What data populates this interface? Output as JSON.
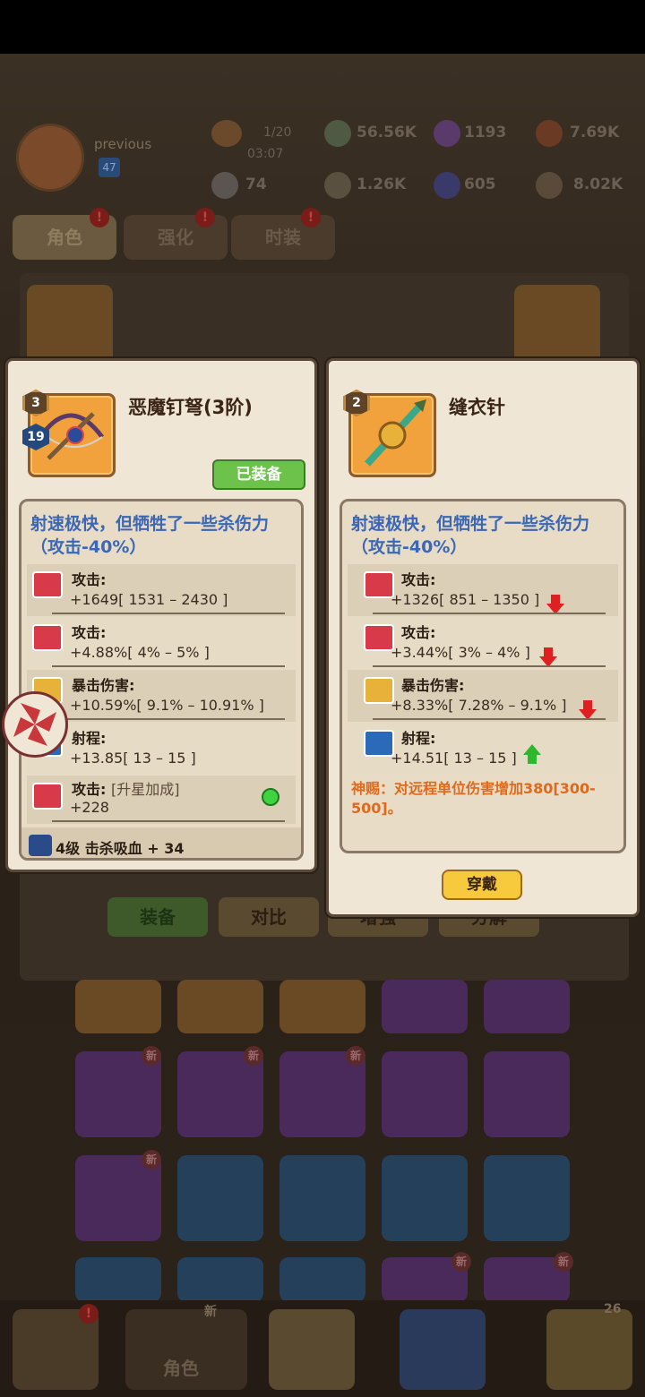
{
  "topbar": {
    "player_name": "previous",
    "player_level": "47",
    "energy_count": "1/20",
    "energy_timer": "03:07",
    "resources": [
      "56.56K",
      "1193",
      "7.69K",
      "74",
      "1.26K",
      "605",
      "8.02K"
    ]
  },
  "tabs": [
    {
      "label": "角色",
      "badge": "!"
    },
    {
      "label": "强化",
      "badge": "!"
    },
    {
      "label": "时装",
      "badge": "!"
    }
  ],
  "grid_badges": {
    "new": "新"
  },
  "bottom_buttons": [
    {
      "label": "装备"
    },
    {
      "label": "对比"
    },
    {
      "label": "增强"
    },
    {
      "label": "分解"
    }
  ],
  "nav": {
    "character_label": "角色",
    "new_badge": "新",
    "alert_badge": "!",
    "count_badge": "26"
  },
  "left_item": {
    "star": "3",
    "level": "19",
    "name": "恶魔钉弩(3阶)",
    "equipped_label": "已装备",
    "desc": "射速极快，但牺牲了一些杀伤力（攻击-40%）",
    "stats": [
      {
        "name": "攻击:",
        "value": "+1649",
        "range": "[ 1531 – 2430 ]"
      },
      {
        "name": "攻击:",
        "value": "+4.88%",
        "range": "[ 4% – 5% ]"
      },
      {
        "name": "暴击伤害:",
        "value": "+10.59%",
        "range": "[ 9.1% – 10.91% ]"
      },
      {
        "name": "射程:",
        "value": "+13.85",
        "range": "[ 13 – 15 ]"
      }
    ],
    "star_bonus": {
      "name": "攻击:",
      "tag": "[升星加成]",
      "value": "+228"
    },
    "skill": {
      "level": "4级",
      "text": "击杀吸血 + 34"
    }
  },
  "right_item": {
    "star": "2",
    "name": "缝衣针",
    "desc": "射速极快，但牺牲了一些杀伤力（攻击-40%）",
    "stats": [
      {
        "name": "攻击:",
        "value": "+1326",
        "range": "[ 851 – 1350 ]",
        "trend": "down"
      },
      {
        "name": "攻击:",
        "value": "+3.44%",
        "range": "[ 3% – 4% ]",
        "trend": "down"
      },
      {
        "name": "暴击伤害:",
        "value": "+8.33%",
        "range": "[ 7.28% – 9.1% ]",
        "trend": "down"
      },
      {
        "name": "射程:",
        "value": "+14.51",
        "range": "[ 13 – 15 ]",
        "trend": "up"
      }
    ],
    "blessing": "神赐：对远程单位伤害增加380[300-500]。",
    "wear_label": "穿戴"
  },
  "colors": {
    "desc_blue": "#3b67b4",
    "blessing_orange": "#e0691b",
    "equipped_green": "#6cc24a",
    "wear_yellow": "#f7c93c"
  }
}
